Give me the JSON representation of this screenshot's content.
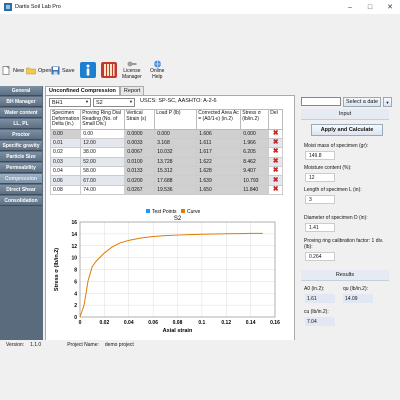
{
  "window": {
    "title": "Dartis Soil Lab Pro"
  },
  "toolbar": {
    "new": "New",
    "open": "Open",
    "save": "Save",
    "license": [
      "License",
      "Manager"
    ],
    "help": [
      "Online",
      "Help"
    ]
  },
  "sidebar": {
    "items": [
      {
        "label": "General",
        "active": false
      },
      {
        "label": "BH Manager",
        "active": false
      },
      {
        "label": "Water content",
        "active": false
      },
      {
        "label": "LL, PL",
        "active": false
      },
      {
        "label": "Proctor",
        "active": false
      },
      {
        "label": "Specific gravity",
        "active": false
      },
      {
        "label": "Particle Size",
        "active": false
      },
      {
        "label": "Permeability",
        "active": false
      },
      {
        "label": "Compression",
        "active": true
      },
      {
        "label": "Direct Shear",
        "active": false
      },
      {
        "label": "Consolidation",
        "active": false
      }
    ]
  },
  "tabs": [
    "Unconfined Compression",
    "Report"
  ],
  "controls": {
    "borehole": "BH1",
    "sample": "S2",
    "uscs": "USCS: SP-SC, AASHTO: A-2-6",
    "date_button": "Select a date"
  },
  "table": {
    "headers": [
      "Specimen Deformation Delta (in.)",
      "Proving Ring Dial Reading (No. of Small Div.)",
      "Vertical Strain (ε)",
      "Load P (lb)",
      "Corrected Area Ac = (A0/1-ε) (in.2)",
      "Stress σ (lb/in.2)",
      "Del"
    ],
    "rows": [
      [
        "0.00",
        "0.00",
        "0.0000",
        "0.000",
        "1.606",
        "0.000"
      ],
      [
        "0.01",
        "12.00",
        "0.0033",
        "3.168",
        "1.611",
        "1.966"
      ],
      [
        "0.02",
        "38.00",
        "0.0067",
        "10.032",
        "1.617",
        "6.205"
      ],
      [
        "0.03",
        "52.00",
        "0.0100",
        "13.728",
        "1.622",
        "8.462"
      ],
      [
        "0.04",
        "58.00",
        "0.0133",
        "15.312",
        "1.628",
        "9.407"
      ],
      [
        "0.06",
        "67.00",
        "0.0200",
        "17.688",
        "1.639",
        "10.793"
      ],
      [
        "0.08",
        "74.00",
        "0.0267",
        "19.536",
        "1.650",
        "11.840"
      ]
    ]
  },
  "input": {
    "header": "Input",
    "calc_button": "Apply and Calculate",
    "moist_label": "Moist mass of specimen (gr):",
    "moist_value": "149.8",
    "moisture_label": "Moisture content (%):",
    "moisture_value": "12",
    "length_label": "Length of specimen L (in):",
    "length_value": "3",
    "diameter_label": "Diameter of specimen D (in):",
    "diameter_value": "1.41",
    "ring_label": "Proving ring calibration factor: 1 div.(lb):",
    "ring_value": "0.264"
  },
  "results": {
    "header": "Results",
    "a0_label": "A0 (in.2):",
    "a0_value": "1.61",
    "qu_label": "qu (lb/in.2):",
    "qu_value": "14.09",
    "cu_label": "cu (lb/in.2):",
    "cu_value": "7.04"
  },
  "status": {
    "version_label": "Version:",
    "version": "1.1.0",
    "project_label": "Project Name:",
    "project": "demo project"
  },
  "chart_data": {
    "type": "line",
    "title": "S2",
    "legend": [
      "Test Points",
      "Curve"
    ],
    "legend_placement": "top",
    "xlabel": "Axial strain",
    "ylabel": "Stress σ (lb/in.2)",
    "xlim": [
      0,
      0.16
    ],
    "ylim": [
      0,
      16
    ],
    "xticks": [
      "0",
      "0.02",
      "0.04",
      "0.06",
      "0.08",
      "0.1",
      "0.12",
      "0.14",
      "0.16"
    ],
    "yticks": [
      "0",
      "2",
      "4",
      "6",
      "8",
      "10",
      "12",
      "14",
      "16"
    ],
    "grid": true,
    "series": [
      {
        "name": "Curve",
        "x": [
          0,
          0.0033,
          0.0067,
          0.01,
          0.0133,
          0.02,
          0.0267,
          0.033,
          0.04,
          0.05,
          0.06,
          0.07,
          0.08,
          0.09,
          0.1,
          0.11,
          0.12,
          0.13,
          0.14,
          0.15
        ],
        "y": [
          0,
          1.97,
          6.2,
          8.46,
          9.41,
          10.79,
          11.84,
          12.5,
          12.9,
          13.3,
          13.55,
          13.7,
          13.8,
          13.87,
          13.93,
          13.98,
          14.02,
          14.05,
          14.08,
          14.09
        ]
      }
    ]
  }
}
